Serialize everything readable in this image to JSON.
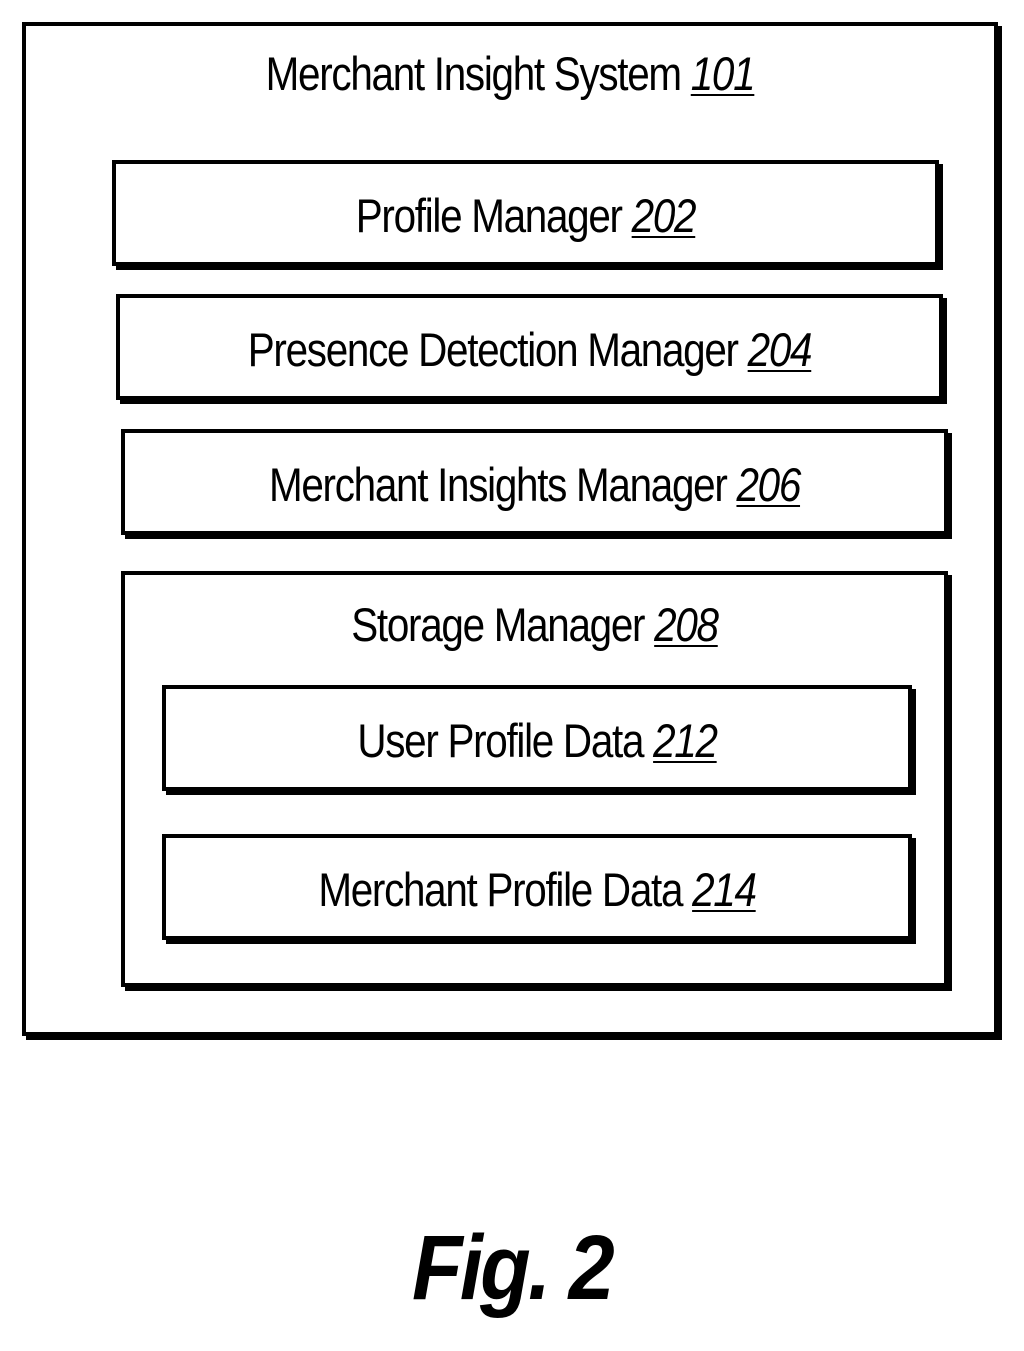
{
  "diagram": {
    "outer": {
      "name": "Merchant Insight System",
      "ref": "101"
    },
    "components": [
      {
        "name": "Profile Manager",
        "ref": "202"
      },
      {
        "name": "Presence Detection Manager",
        "ref": "204"
      },
      {
        "name": "Merchant Insights Manager",
        "ref": "206"
      }
    ],
    "storage": {
      "name": "Storage Manager",
      "ref": "208",
      "items": [
        {
          "name": "User Profile Data",
          "ref": "212"
        },
        {
          "name": "Merchant Profile Data",
          "ref": "214"
        }
      ]
    }
  },
  "figure_label": "Fig. 2"
}
